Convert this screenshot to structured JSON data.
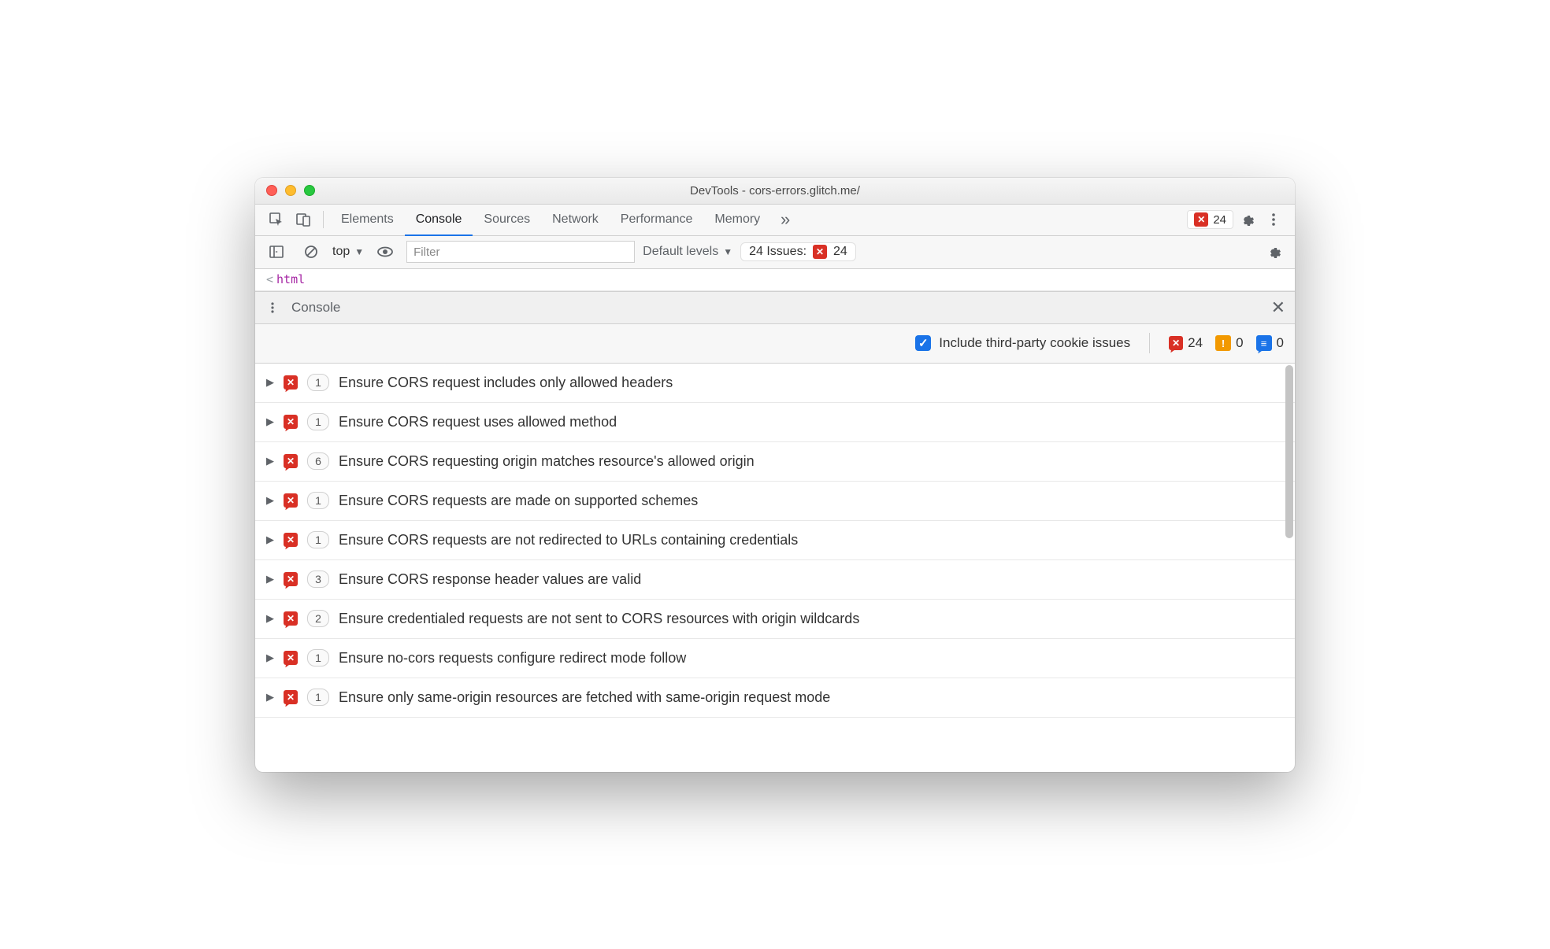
{
  "window": {
    "title": "DevTools - cors-errors.glitch.me/"
  },
  "tabs": {
    "items": [
      "Elements",
      "Console",
      "Sources",
      "Network",
      "Performance",
      "Memory"
    ],
    "active_index": 1,
    "error_count": "24"
  },
  "toolbar": {
    "context": "top",
    "filter_placeholder": "Filter",
    "levels_label": "Default levels",
    "issues_label": "24 Issues:",
    "issues_count": "24"
  },
  "source_hint": {
    "tag": "html"
  },
  "drawer": {
    "title": "Console"
  },
  "filter_row": {
    "checkbox_label": "Include third-party cookie issues",
    "errors": "24",
    "warnings": "0",
    "info": "0"
  },
  "issues": [
    {
      "count": "1",
      "text": "Ensure CORS request includes only allowed headers"
    },
    {
      "count": "1",
      "text": "Ensure CORS request uses allowed method"
    },
    {
      "count": "6",
      "text": "Ensure CORS requesting origin matches resource's allowed origin"
    },
    {
      "count": "1",
      "text": "Ensure CORS requests are made on supported schemes"
    },
    {
      "count": "1",
      "text": "Ensure CORS requests are not redirected to URLs containing credentials"
    },
    {
      "count": "3",
      "text": "Ensure CORS response header values are valid"
    },
    {
      "count": "2",
      "text": "Ensure credentialed requests are not sent to CORS resources with origin wildcards"
    },
    {
      "count": "1",
      "text": "Ensure no-cors requests configure redirect mode follow"
    },
    {
      "count": "1",
      "text": "Ensure only same-origin resources are fetched with same-origin request mode"
    }
  ]
}
